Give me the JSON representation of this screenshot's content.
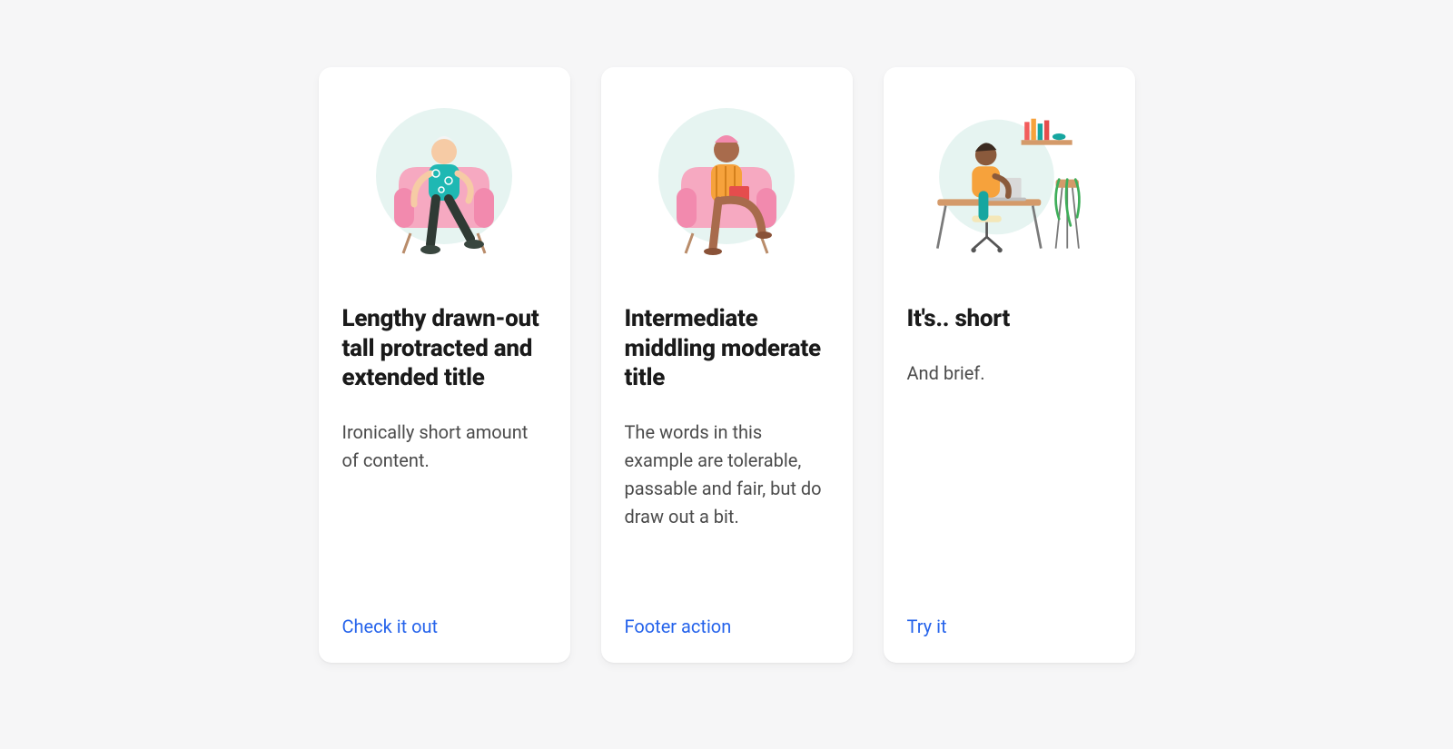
{
  "cards": [
    {
      "title": "Lengthy drawn-out tall protracted and extended title",
      "body": "Ironically short amount of content.",
      "action": "Check it out"
    },
    {
      "title": "Intermediate middling moderate title",
      "body": "The words in this example are tolerable, passable and fair, but do draw out a bit.",
      "action": "Footer action"
    },
    {
      "title": "It's.. short",
      "body": "And brief.",
      "action": "Try it"
    }
  ],
  "colors": {
    "pageBg": "#F6F6F7",
    "cardBg": "#FFFFFF",
    "title": "#1a1a1a",
    "body": "#4b4b4b",
    "link": "#2563EB"
  }
}
